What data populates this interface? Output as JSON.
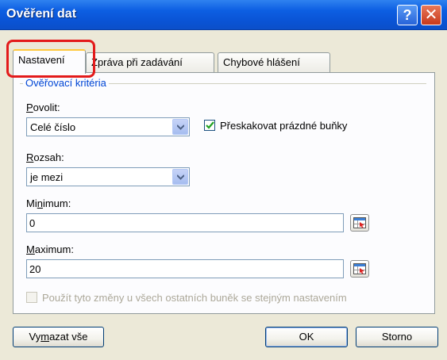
{
  "window": {
    "title": "Ověření dat",
    "help_glyph": "?",
    "close_glyph": "✕"
  },
  "tabs": [
    {
      "label": "Nastavení",
      "active": true
    },
    {
      "label": "Zpráva při zadávání",
      "active": false
    },
    {
      "label": "Chybové hlášení",
      "active": false
    }
  ],
  "group": {
    "label": "Ověřovací kritéria"
  },
  "allow": {
    "label": "Povolit:",
    "value": "Celé číslo"
  },
  "ignore_blank": {
    "label": "Přeskakovat prázdné buňky",
    "checked": true
  },
  "range": {
    "label": "Rozsah:",
    "value": "je mezi"
  },
  "minimum": {
    "label": "Minimum:",
    "value": "0"
  },
  "maximum": {
    "label": "Maximum:",
    "value": "20"
  },
  "apply_all": {
    "label": "Použít tyto změny u všech ostatních buněk se stejným nastavením",
    "checked": false,
    "enabled": false
  },
  "buttons": {
    "clear": "Vymazat vše",
    "ok": "OK",
    "cancel": "Storno"
  },
  "colors": {
    "title_bar": "#0a54d6",
    "highlight": "#e31b1b",
    "group_label": "#0046d5",
    "dialog_bg": "#ece9d8"
  }
}
